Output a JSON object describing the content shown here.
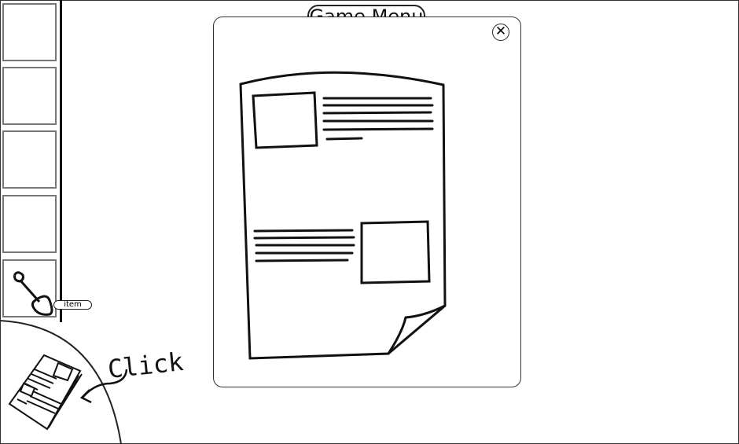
{
  "header": {
    "game_menu_label": "Game Menu"
  },
  "inventory": {
    "slots": [
      {
        "item": ""
      },
      {
        "item": ""
      },
      {
        "item": ""
      },
      {
        "item": ""
      },
      {
        "item": "shovel-icon"
      }
    ],
    "tooltip": "item"
  },
  "modal": {
    "content": "newspaper-icon",
    "close_icon": "close-icon",
    "close_glyph": "✕"
  },
  "hint": {
    "label": "Click",
    "target": "newspaper-icon"
  }
}
